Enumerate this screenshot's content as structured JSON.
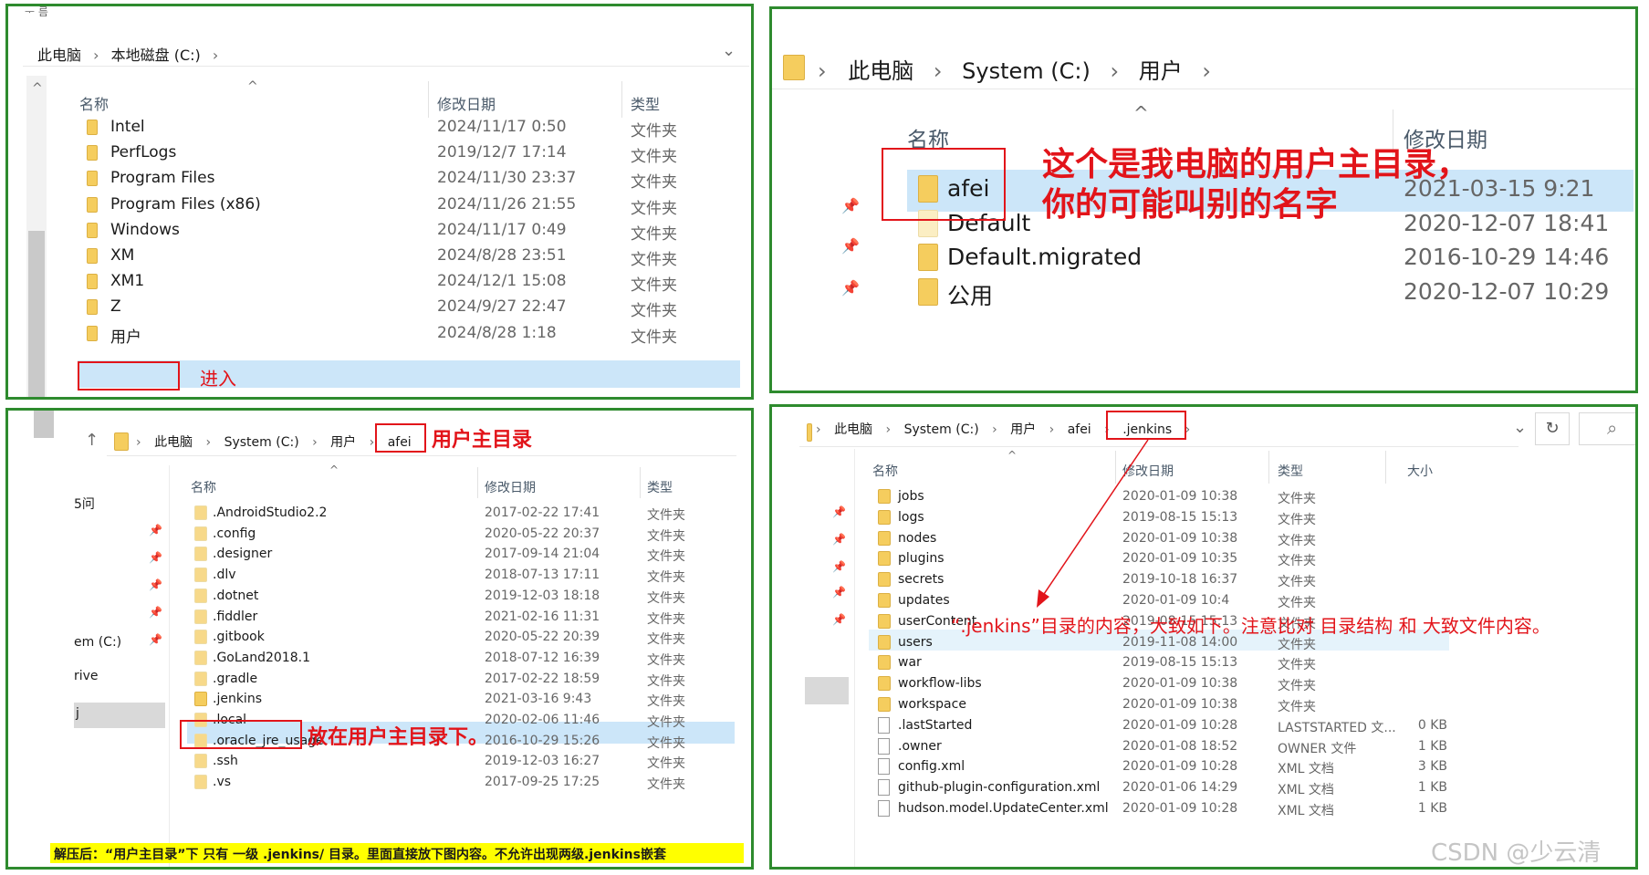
{
  "p1": {
    "top_fragment": "ᅮ   름",
    "crumbs": [
      "此电脑",
      "本地磁盘 (C:)"
    ],
    "sep": "›",
    "columns": [
      "名称",
      "修改日期",
      "类型"
    ],
    "rows": [
      {
        "name": "Intel",
        "date": "2024/11/17 0:50",
        "type": "文件夹"
      },
      {
        "name": "PerfLogs",
        "date": "2019/12/7 17:14",
        "type": "文件夹"
      },
      {
        "name": "Program Files",
        "date": "2024/11/30 23:37",
        "type": "文件夹"
      },
      {
        "name": "Program Files (x86)",
        "date": "2024/11/26 21:55",
        "type": "文件夹"
      },
      {
        "name": "Windows",
        "date": "2024/11/17 0:49",
        "type": "文件夹"
      },
      {
        "name": "XM",
        "date": "2024/8/28 23:51",
        "type": "文件夹"
      },
      {
        "name": "XM1",
        "date": "2024/12/1 15:08",
        "type": "文件夹"
      },
      {
        "name": "Z",
        "date": "2024/9/27 22:47",
        "type": "文件夹"
      },
      {
        "name": "用户",
        "date": "2024/8/28 1:18",
        "type": "文件夹"
      }
    ],
    "annotation": "进入"
  },
  "p2": {
    "crumbs": [
      "此电脑",
      "System (C:)",
      "用户"
    ],
    "sep": "›",
    "columns": [
      "名称",
      "修改日期"
    ],
    "rows": [
      {
        "name": "afei",
        "date": "2021-03-15 9:21"
      },
      {
        "name": "Default",
        "date": "2020-12-07 18:41"
      },
      {
        "name": "Default.migrated",
        "date": "2016-10-29 14:46"
      },
      {
        "name": "公用",
        "date": "2020-12-07 10:29"
      }
    ],
    "annotation_line1": "这个是我电脑的用户主目录，",
    "annotation_line2": "你的可能叫别的名字"
  },
  "p3": {
    "crumbs": [
      "此电脑",
      "System (C:)",
      "用户",
      "afei"
    ],
    "sep": "›",
    "up_arrow": "↑",
    "title_annotation": "用户主目录",
    "columns": [
      "名称",
      "修改日期",
      "类型"
    ],
    "side_labels": [
      "5问",
      "em (C:)",
      "rive",
      "j"
    ],
    "rows": [
      {
        "name": ".AndroidStudio2.2",
        "date": "2017-02-22 17:41",
        "type": "文件夹"
      },
      {
        "name": ".config",
        "date": "2020-05-22 20:37",
        "type": "文件夹"
      },
      {
        "name": ".designer",
        "date": "2017-09-14 21:04",
        "type": "文件夹"
      },
      {
        "name": ".dlv",
        "date": "2018-07-13 17:11",
        "type": "文件夹"
      },
      {
        "name": ".dotnet",
        "date": "2019-12-03 18:18",
        "type": "文件夹"
      },
      {
        "name": ".fiddler",
        "date": "2021-02-16 11:31",
        "type": "文件夹"
      },
      {
        "name": ".gitbook",
        "date": "2020-05-22 20:39",
        "type": "文件夹"
      },
      {
        "name": ".GoLand2018.1",
        "date": "2018-07-12 16:39",
        "type": "文件夹"
      },
      {
        "name": ".gradle",
        "date": "2017-02-22 18:59",
        "type": "文件夹"
      },
      {
        "name": ".jenkins",
        "date": "2021-03-16 9:43",
        "type": "文件夹"
      },
      {
        "name": ".local",
        "date": "2020-02-06 11:46",
        "type": "文件夹"
      },
      {
        "name": ".oracle_jre_usage",
        "date": "2016-10-29 15:26",
        "type": "文件夹"
      },
      {
        "name": ".ssh",
        "date": "2019-12-03 16:27",
        "type": "文件夹"
      },
      {
        "name": ".vs",
        "date": "2017-09-25 17:25",
        "type": "文件夹"
      }
    ],
    "jenkins_annotation": "放在用户主目录下。",
    "footer": "解压后：“用户主目录”下 只有 一级 .jenkins/ 目录。里面直接放下图内容。不允许出现两级.jenkins嵌套"
  },
  "p4": {
    "crumbs": [
      "此电脑",
      "System (C:)",
      "用户",
      "afei",
      ".jenkins"
    ],
    "sep": "›",
    "columns": [
      "名称",
      "修改日期",
      "类型",
      "大小"
    ],
    "rows": [
      {
        "name": "jobs",
        "date": "2020-01-09 10:38",
        "type": "文件夹",
        "size": "",
        "kind": "folder"
      },
      {
        "name": "logs",
        "date": "2019-08-15 15:13",
        "type": "文件夹",
        "size": "",
        "kind": "folder"
      },
      {
        "name": "nodes",
        "date": "2020-01-09 10:38",
        "type": "文件夹",
        "size": "",
        "kind": "folder"
      },
      {
        "name": "plugins",
        "date": "2020-01-09 10:35",
        "type": "文件夹",
        "size": "",
        "kind": "folder"
      },
      {
        "name": "secrets",
        "date": "2019-10-18 16:37",
        "type": "文件夹",
        "size": "",
        "kind": "folder"
      },
      {
        "name": "updates",
        "date": "2020-01-09 10:4",
        "type": "文件夹",
        "size": "",
        "kind": "folder"
      },
      {
        "name": "userContent",
        "date": "2019-08-15 15:13",
        "type": "文件夹",
        "size": "",
        "kind": "folder"
      },
      {
        "name": "users",
        "date": "2019-11-08 14:00",
        "type": "文件夹",
        "size": "",
        "kind": "folder"
      },
      {
        "name": "war",
        "date": "2019-08-15 15:13",
        "type": "文件夹",
        "size": "",
        "kind": "folder"
      },
      {
        "name": "workflow-libs",
        "date": "2020-01-09 10:38",
        "type": "文件夹",
        "size": "",
        "kind": "folder"
      },
      {
        "name": "workspace",
        "date": "2020-01-09 10:38",
        "type": "文件夹",
        "size": "",
        "kind": "folder"
      },
      {
        "name": ".lastStarted",
        "date": "2020-01-09 10:28",
        "type": "LASTSTARTED 文...",
        "size": "0 KB",
        "kind": "file"
      },
      {
        "name": ".owner",
        "date": "2020-01-08 18:52",
        "type": "OWNER 文件",
        "size": "1 KB",
        "kind": "file"
      },
      {
        "name": "config.xml",
        "date": "2020-01-09 10:28",
        "type": "XML 文档",
        "size": "3 KB",
        "kind": "file"
      },
      {
        "name": "github-plugin-configuration.xml",
        "date": "2020-01-06 14:29",
        "type": "XML 文档",
        "size": "1 KB",
        "kind": "file"
      },
      {
        "name": "hudson.model.UpdateCenter.xml",
        "date": "2020-01-09 10:28",
        "type": "XML 文档",
        "size": "1 KB",
        "kind": "file"
      }
    ],
    "annotation": "“.jenkins”目录的内容，大致如下。注意比对 目录结构 和 大致文件内容。",
    "watermark": "CSDN @少云清"
  },
  "icons": {
    "pin": "📌",
    "refresh": "↻",
    "search": "⌕",
    "chevron_down": "⌄",
    "sort_up": "^"
  },
  "colors": {
    "border": "#2e8b2e",
    "annotation": "#e2141a",
    "selection": "#cce6f9",
    "folder": "#f5cd5e",
    "footer_bg": "#ffff00"
  }
}
